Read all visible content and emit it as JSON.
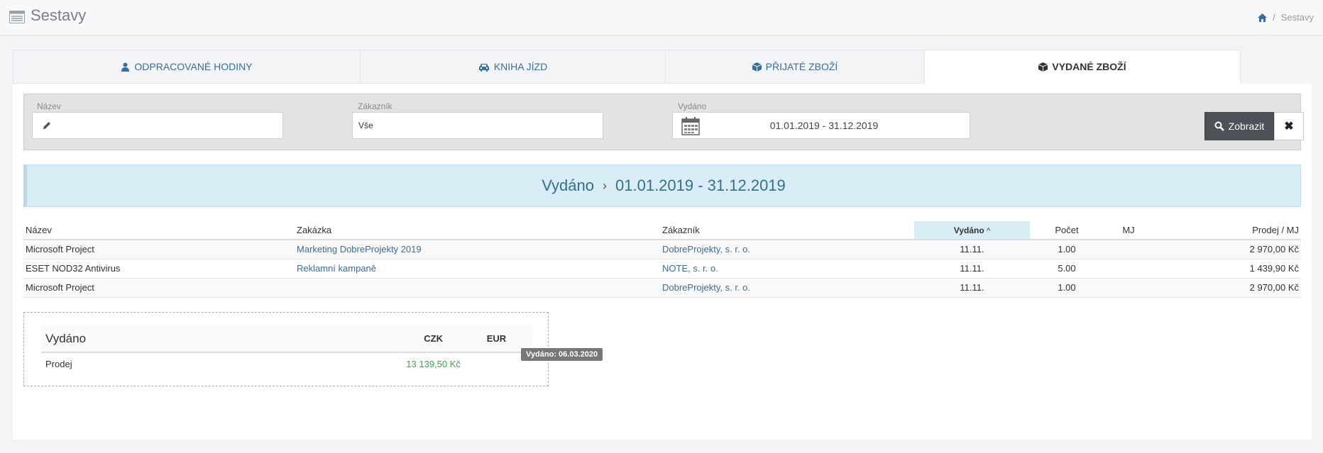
{
  "header": {
    "title": "Sestavy",
    "breadcrumb": {
      "current": "Sestavy",
      "separator": "/"
    }
  },
  "tabs": [
    {
      "label": "ODPRACOVANÉ HODINY",
      "icon": "user-icon",
      "active": false
    },
    {
      "label": "KNIHA JÍZD",
      "icon": "car-icon",
      "active": false
    },
    {
      "label": "PŘIJATÉ ZBOŽÍ",
      "icon": "box-icon",
      "active": false
    },
    {
      "label": "VYDANÉ ZBOŽÍ",
      "icon": "box-icon",
      "active": true
    }
  ],
  "filter": {
    "name_label": "Název",
    "name_value": "",
    "customer_label": "Zákazník",
    "customer_value": "Vše",
    "issued_label": "Vydáno",
    "issued_value": "01.01.2019 - 31.12.2019",
    "show_button": "Zobrazit",
    "clear_button": "✖"
  },
  "banner": {
    "label": "Vydáno",
    "separator": "›",
    "range": "01.01.2019 - 31.12.2019"
  },
  "table": {
    "columns": [
      "Název",
      "Zakázka",
      "Zákazník",
      "Vydáno",
      "Počet",
      "MJ",
      "Prodej / MJ"
    ],
    "sorted_column": "Vydáno",
    "sort_indicator": "^",
    "rows": [
      [
        "Microsoft Project",
        "Marketing DobreProjekty 2019",
        "DobreProjekty, s. r. o.",
        "11.11.",
        "1.00",
        "",
        "2 970,00 Kč"
      ],
      [
        "ESET NOD32 Antivirus",
        "Reklamní kampaně",
        "NOTE, s. r. o.",
        "11.11.",
        "5.00",
        "",
        "1 439,90 Kč"
      ],
      [
        "Microsoft Project",
        "",
        "DobreProjekty, s. r. o.",
        "11.11.",
        "1.00",
        "",
        "2 970,00 Kč"
      ]
    ]
  },
  "summary": {
    "title": "Vydáno",
    "col_czk": "CZK",
    "col_eur": "EUR",
    "row_label": "Prodej",
    "czk_value": "13 139,50 Kč",
    "eur_value": ""
  },
  "footer": {
    "badge": "Vydáno: 06.03.2020"
  },
  "colors": {
    "accent": "#3a6d9c",
    "banner_bg": "#d9edf7",
    "banner_text": "#31708f",
    "positive": "#3aa64a",
    "dark_button": "#4c5257"
  }
}
